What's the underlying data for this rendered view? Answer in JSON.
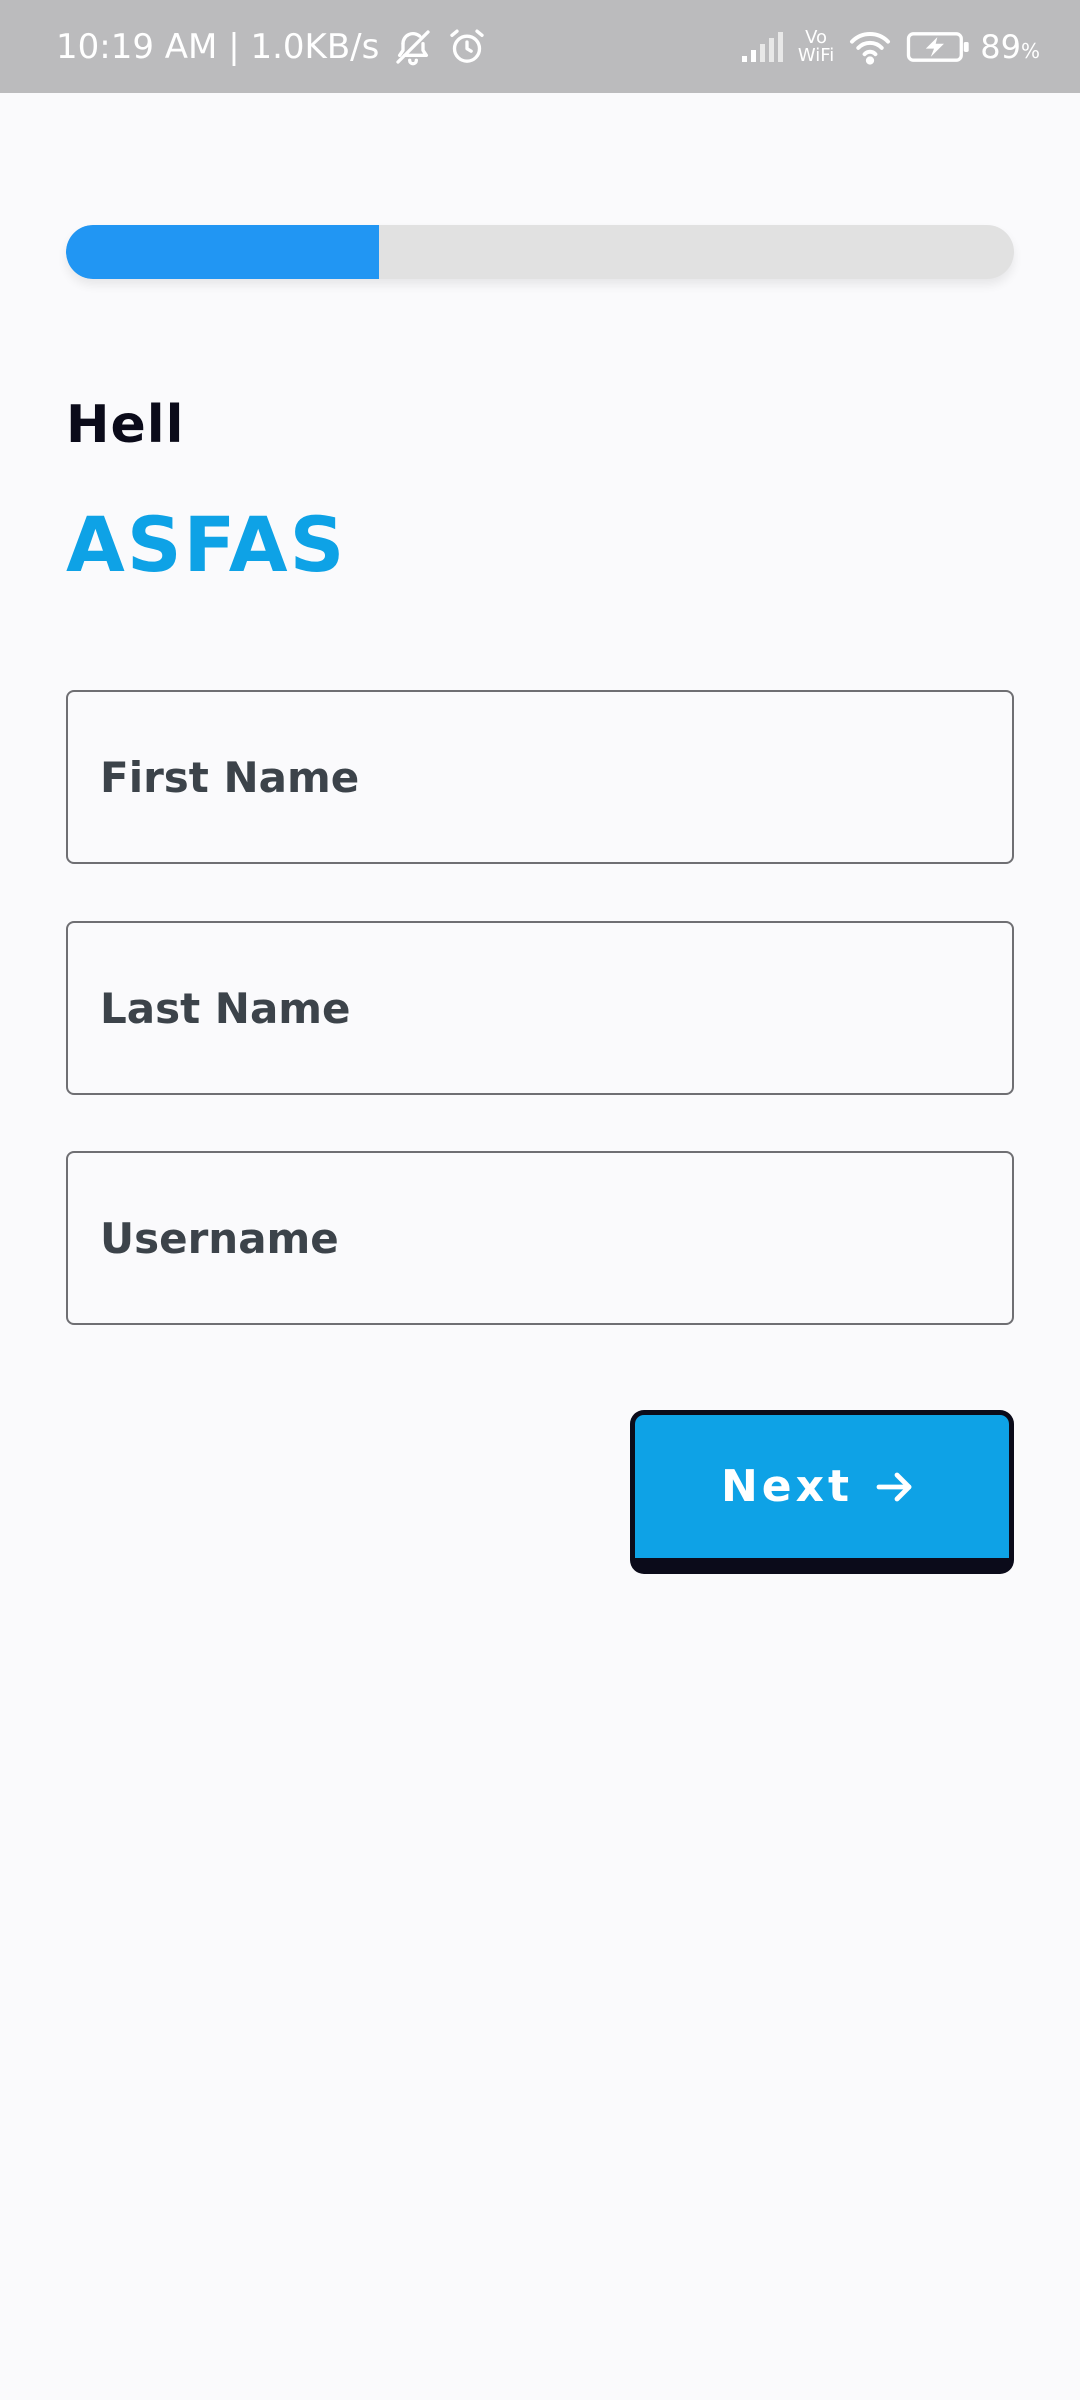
{
  "status_bar": {
    "time_speed": "10:19 AM | 1.0KB/s",
    "vowifi_top": "Vo",
    "vowifi_bottom": "WiFi",
    "battery": "89",
    "battery_unit": "%"
  },
  "progress": {
    "fraction": 0.33,
    "color": "#2196f3",
    "track_color": "#e1e1e1"
  },
  "greeting": {
    "line1": "Hell",
    "name": "ASFAS"
  },
  "form": {
    "first_name_placeholder": "First Name",
    "last_name_placeholder": "Last Name",
    "username_placeholder": "Username"
  },
  "next_button": {
    "label": "Next",
    "icon": "arrow-right-icon"
  },
  "colors": {
    "accent": "#0ea2e6",
    "dark": "#0b0b1a",
    "field_text": "#3c434a",
    "background": "#fafafc"
  }
}
